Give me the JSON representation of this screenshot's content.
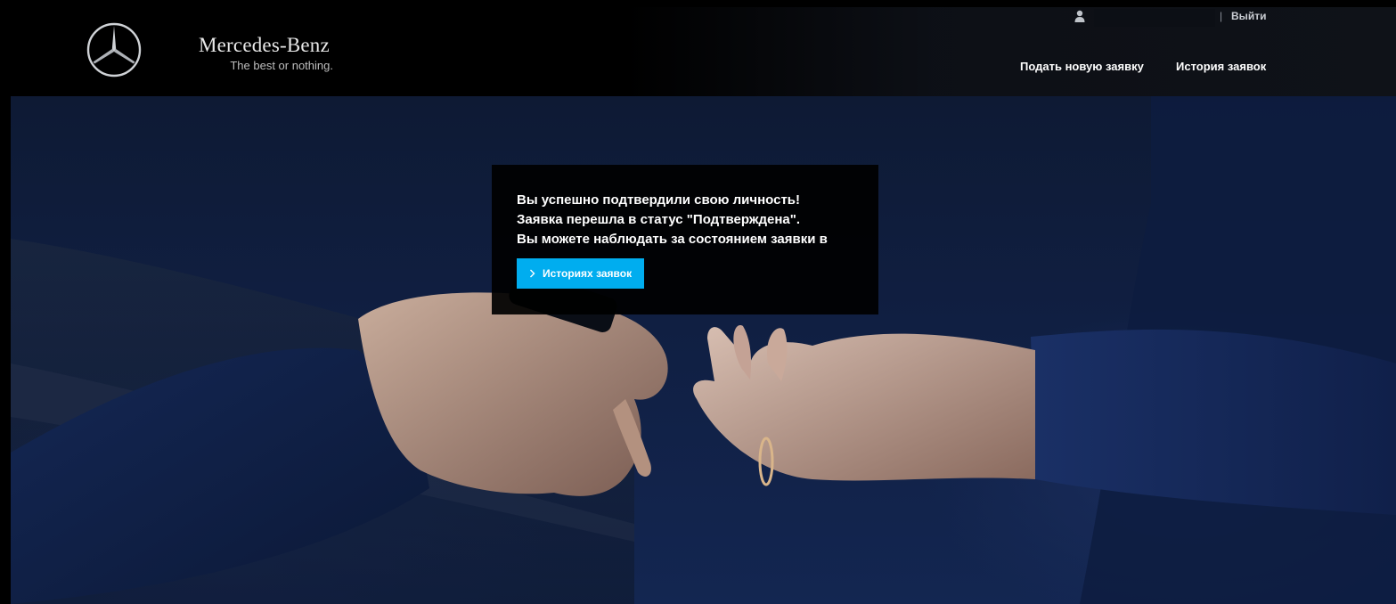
{
  "brand": {
    "name": "Mercedes-Benz",
    "slogan": "The best or nothing.",
    "logo_icon": "mercedes-star-icon"
  },
  "header": {
    "user_icon": "user-icon",
    "separator": "|",
    "logout_label": "Выйти",
    "nav": {
      "new_request_label": "Подать новую заявку",
      "history_label": "История заявок"
    }
  },
  "notice": {
    "line1": "Вы успешно подтвердили свою личность!",
    "line2": "Заявка перешла в статус \"Подтверждена\".",
    "line3": "Вы можете наблюдать за состоянием заявки в",
    "button_label": "Историях заявок",
    "button_icon": "chevron-right-icon"
  },
  "colors": {
    "accent": "#00adef",
    "header_bg": "#000000",
    "hero_bg": "#101f42"
  }
}
